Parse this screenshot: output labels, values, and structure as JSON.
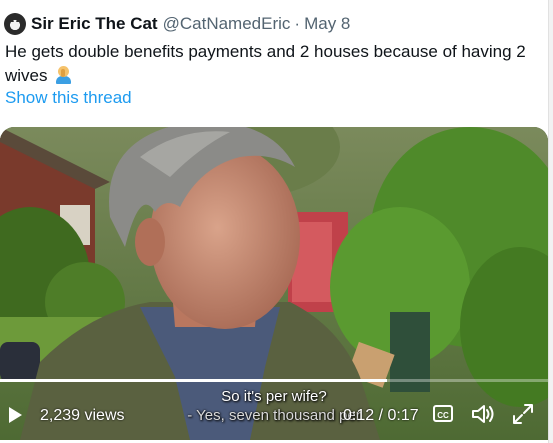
{
  "tweet": {
    "display_name": "Sir Eric The Cat",
    "handle": "@CatNamedEric",
    "separator": "·",
    "date": "May 8",
    "text": "He gets double benefits payments and 2 houses because of having 2 wives",
    "emoji": "man-facepalming",
    "show_thread": "Show this thread"
  },
  "video": {
    "subtitle_line1": "So it's per wife?",
    "subtitle_line2": "- Yes, seven thousand per",
    "views": "2,239 views",
    "time_display": "0:12 / 0:17",
    "progress": 0.706,
    "cc_label": "CC",
    "icons": [
      "play-icon",
      "closed-captions-icon",
      "volume-icon",
      "fullscreen-icon"
    ]
  },
  "colors": {
    "link": "#1d9bf0",
    "text": "#0f1419",
    "muted": "#536471"
  }
}
